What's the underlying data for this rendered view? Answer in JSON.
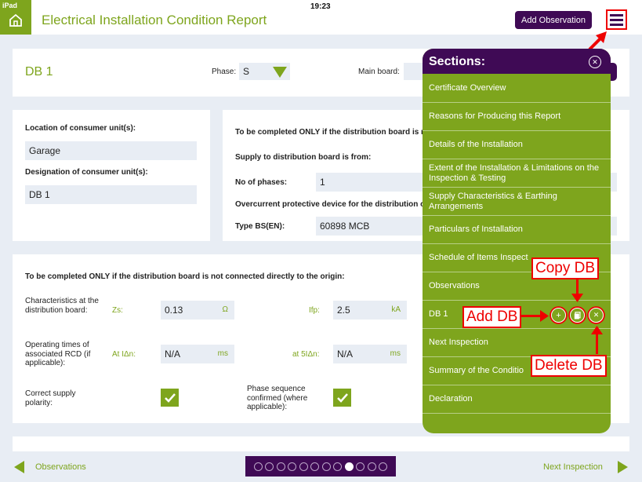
{
  "status_bar": {
    "carrier": "iPad",
    "time": "19:23"
  },
  "header": {
    "title": "Electrical Installation Condition Report",
    "add_observation_label": "Add Observation"
  },
  "db_header": {
    "title": "DB 1",
    "phase_label": "Phase:",
    "phase_value": "S",
    "main_board_label": "Main board:"
  },
  "consumer_unit": {
    "location_label": "Location of consumer unit(s):",
    "location_value": "Garage",
    "designation_label": "Designation of consumer unit(s):",
    "designation_value": "DB 1"
  },
  "supply": {
    "note": "To be completed ONLY if the distribution board is n",
    "supply_from_label": "Supply to distribution board is from:",
    "phases_label": "No of phases:",
    "phases_value": "1",
    "ocpd_label": "Overcurrent protective device for the distribution c",
    "type_label": "Type BS(EN):",
    "type_value": "60898 MCB"
  },
  "origin": {
    "note": "To be completed ONLY if the distribution board is not connected directly to the origin:",
    "characteristics_label": "Characteristics at the distribution board:",
    "zs_label": "Zs:",
    "zs_value": "0.13",
    "zs_unit": "Ω",
    "ifp_label": "Ifp:",
    "ifp_value": "2.5",
    "ifp_unit": "kA",
    "rcd_label": "Operating times of associated RCD (if applicable):",
    "at_idn_label": "At IΔn:",
    "at_idn_value": "N/A",
    "at_idn_unit": "ms",
    "at_5idn_label": "at 5IΔn:",
    "at_5idn_value": "N/A",
    "at_5idn_unit": "ms",
    "polarity_label": "Correct supply polarity:",
    "polarity_checked": true,
    "phase_seq_label": "Phase sequence confirmed (where applicable):",
    "phase_seq_checked": true
  },
  "sections_panel": {
    "title": "Sections:",
    "items": [
      {
        "label": "Certificate Overview"
      },
      {
        "label": "Reasons for Producing this Report"
      },
      {
        "label": "Details of the Installation"
      },
      {
        "label": "Extent of the Installation & Limitations on the Inspection & Testing"
      },
      {
        "label": "Supply Characteristics & Earthing Arrangements"
      },
      {
        "label": "Particulars of Installation"
      },
      {
        "label": "Schedule of Items Inspect"
      },
      {
        "label": "Observations"
      },
      {
        "label": "DB 1"
      },
      {
        "label": "Next Inspection"
      },
      {
        "label": "Summary of the Conditio"
      },
      {
        "label": "Declaration"
      }
    ]
  },
  "annotations": {
    "copy_db": "Copy DB",
    "add_db": "Add DB",
    "delete_db": "Delete DB"
  },
  "footer": {
    "prev_label": "Observations",
    "next_label": "Next Inspection",
    "page_count": 12,
    "current_page": 9
  },
  "colors": {
    "brand_green": "#7ea51d",
    "brand_purple": "#3f0a55",
    "annotation_red": "#ee0000"
  }
}
